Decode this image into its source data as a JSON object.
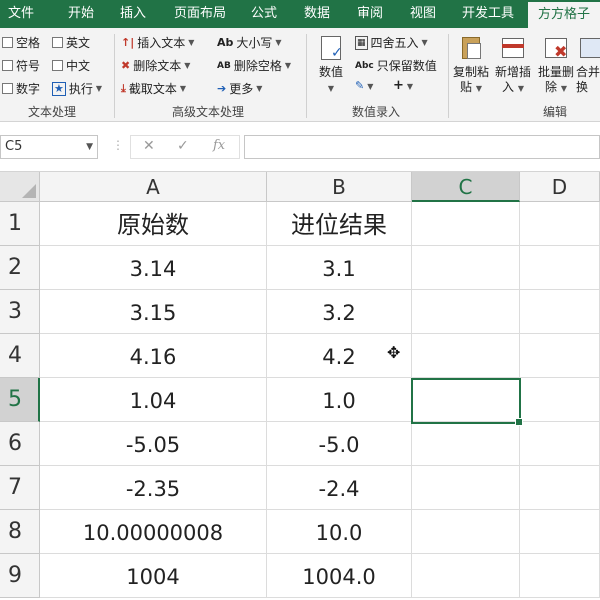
{
  "tabs": [
    "文件",
    "开始",
    "插入",
    "页面布局",
    "公式",
    "数据",
    "审阅",
    "视图",
    "开发工具",
    "方方格子"
  ],
  "ribbon": {
    "text_processing": {
      "checkboxes": [
        "空格",
        "英文",
        "符号",
        "中文",
        "数字"
      ],
      "execute": "执行",
      "label": "文本处理"
    },
    "advanced_text": {
      "insert_text": "插入文本",
      "case": "大小写",
      "delete_text": "删除文本",
      "delete_spaces": "删除空格",
      "extract_text": "截取文本",
      "more": "更多",
      "label": "高级文本处理"
    },
    "value_entry": {
      "value": "数值",
      "round": "四舍五入",
      "keep_value": "只保留数值",
      "label": "数值录入"
    },
    "edit": {
      "copy_paste_l1": "复制粘",
      "copy_paste_l2": "贴",
      "new_insert_l1": "新增插",
      "new_insert_l2": "入",
      "batch_delete_l1": "批量删",
      "batch_delete_l2": "除",
      "merge_l1": "合并",
      "merge_l2": "换",
      "label": "编辑"
    }
  },
  "formula_bar": {
    "name_box": "C5",
    "cancel_icon": "✕",
    "enter_icon": "✓",
    "fx_label": "fx",
    "content": ""
  },
  "grid": {
    "columns": [
      "A",
      "B",
      "C",
      "D"
    ],
    "selected_column": "C",
    "rows": [
      "1",
      "2",
      "3",
      "4",
      "5",
      "6",
      "7",
      "8",
      "9"
    ],
    "selected_row": "5",
    "data": [
      [
        "原始数",
        "进位结果"
      ],
      [
        "3.14",
        "3.1"
      ],
      [
        "3.15",
        "3.2"
      ],
      [
        "4.16",
        "4.2"
      ],
      [
        "1.04",
        "1.0"
      ],
      [
        "-5.05",
        "-5.0"
      ],
      [
        "-2.35",
        "-2.4"
      ],
      [
        "10.00000008",
        "10.0"
      ],
      [
        "1004",
        "1004.0"
      ]
    ]
  }
}
